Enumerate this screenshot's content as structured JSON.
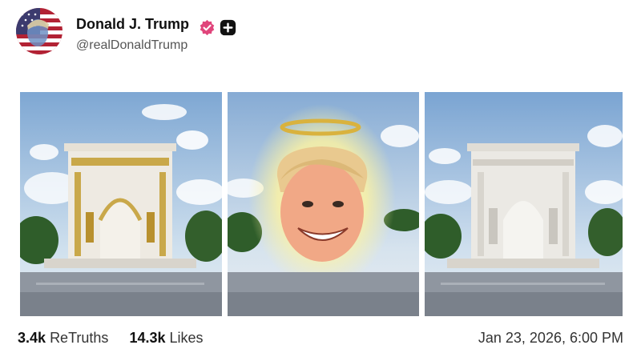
{
  "post": {
    "author_name": "Donald J. Trump",
    "author_handle": "@realDonaldTrump",
    "retruths_count": "3.4k",
    "retruths_label": "ReTruths",
    "likes_count": "14.3k",
    "likes_label": "Likes",
    "timestamp": "Jan 23, 2026, 6:00 PM"
  },
  "icons": {
    "verified": "verified-badge-icon",
    "plus": "plus-badge-icon"
  },
  "colors": {
    "verified_badge": "#e0457b",
    "plus_badge": "#111111"
  },
  "media": [
    {
      "name": "gilded-arch-image"
    },
    {
      "name": "halo-portrait-image"
    },
    {
      "name": "white-arch-image"
    }
  ]
}
